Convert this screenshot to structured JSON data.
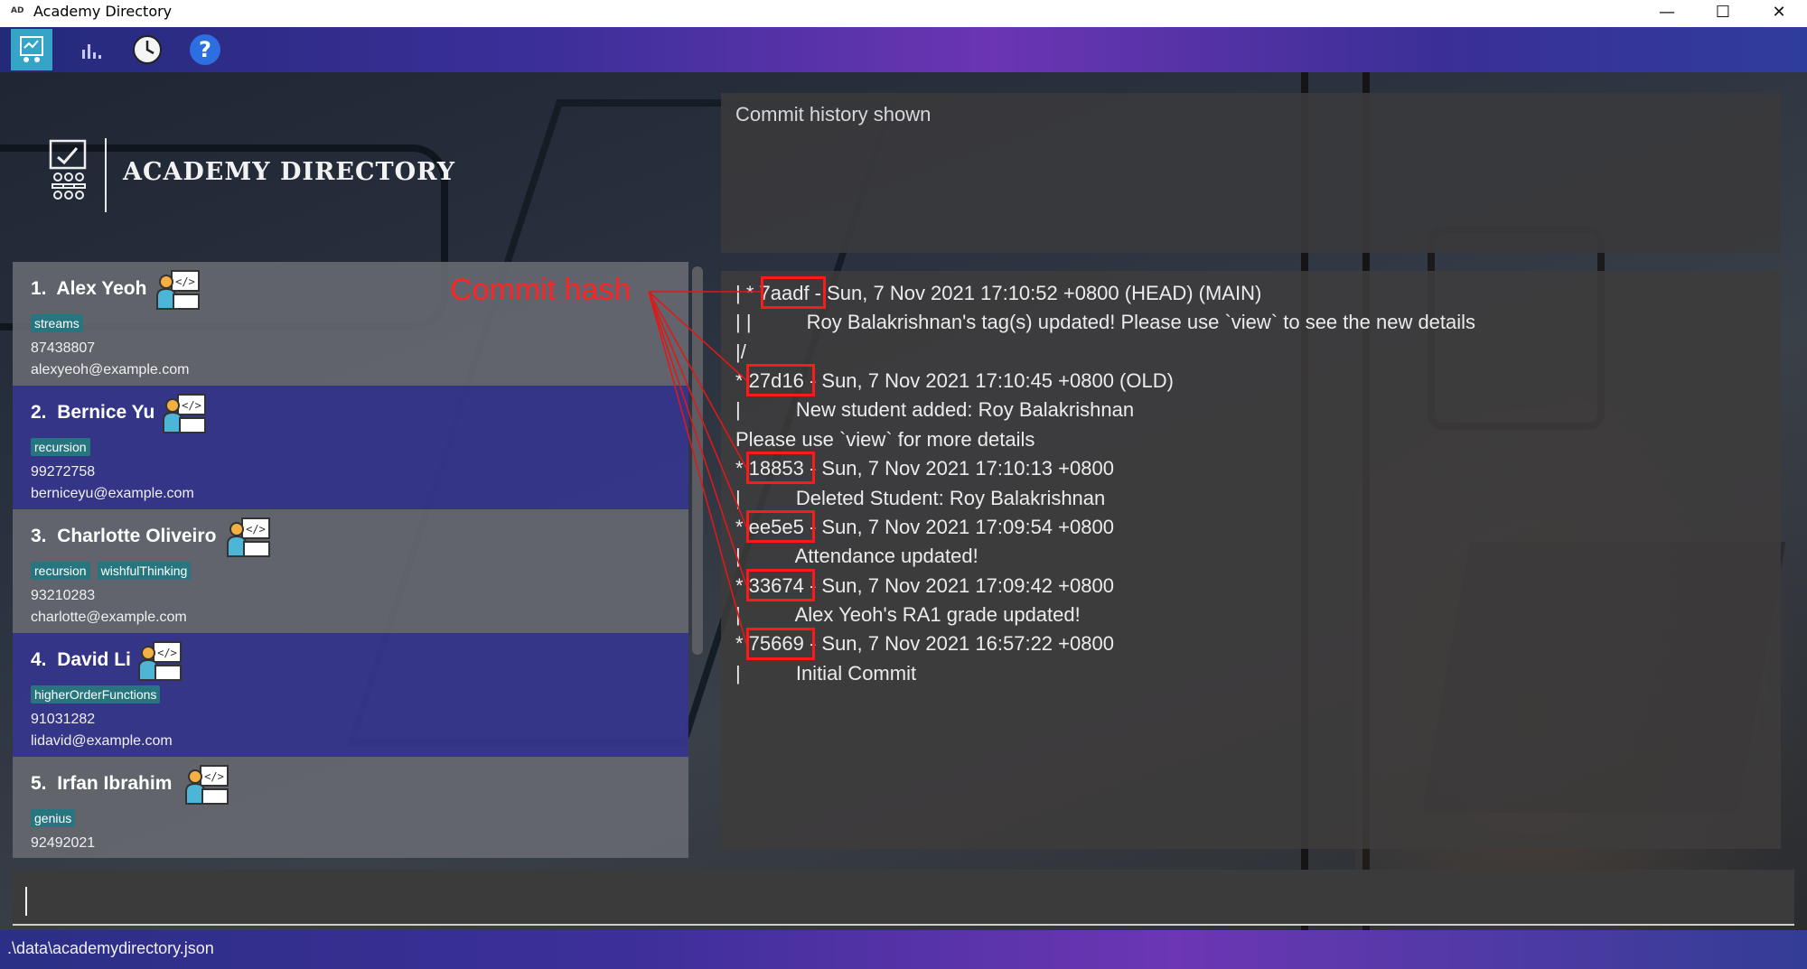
{
  "window": {
    "title": "Academy Directory",
    "app_icon_text": "AD",
    "minimize": "—",
    "maximize": "☐",
    "close": "✕"
  },
  "toolbar": {
    "items": [
      {
        "name": "directory",
        "icon": "directory-icon",
        "active": true
      },
      {
        "name": "visualize",
        "icon": "bar-chart-icon"
      },
      {
        "name": "history",
        "icon": "clock-icon"
      },
      {
        "name": "help",
        "icon": "help-icon"
      }
    ]
  },
  "brand": {
    "title": "ACADEMY DIRECTORY"
  },
  "students": [
    {
      "index": "1.",
      "name": "Alex Yeoh",
      "tags": [
        "streams"
      ],
      "phone": "87438807",
      "email": "alexyeoh@example.com"
    },
    {
      "index": "2.",
      "name": "Bernice Yu",
      "tags": [
        "recursion"
      ],
      "phone": "99272758",
      "email": "berniceyu@example.com"
    },
    {
      "index": "3.",
      "name": "Charlotte Oliveiro",
      "tags": [
        "recursion",
        "wishfulThinking"
      ],
      "phone": "93210283",
      "email": "charlotte@example.com"
    },
    {
      "index": "4.",
      "name": "David Li",
      "tags": [
        "higherOrderFunctions"
      ],
      "phone": "91031282",
      "email": "lidavid@example.com"
    },
    {
      "index": "5.",
      "name": "Irfan Ibrahim",
      "tags": [
        "genius"
      ],
      "phone": "92492021",
      "email": ""
    }
  ],
  "result": {
    "text": "Commit history shown"
  },
  "annotation": {
    "label": "Commit hash",
    "color": "#ff2424"
  },
  "commit_log": {
    "lines": [
      "| * 7aadf - Sun, 7 Nov 2021 17:10:52 +0800 (HEAD) (MAIN)",
      "| |          Roy Balakrishnan's tag(s) updated! Please use `view` to see the new details",
      "|/",
      "* 27d16 - Sun, 7 Nov 2021 17:10:45 +0800 (OLD)",
      "|          New student added: Roy Balakrishnan",
      "Please use `view` for more details",
      "* 18853 - Sun, 7 Nov 2021 17:10:13 +0800",
      "|          Deleted Student: Roy Balakrishnan",
      "* ee5e5 - Sun, 7 Nov 2021 17:09:54 +0800",
      "|          Attendance updated!",
      "* 33674 - Sun, 7 Nov 2021 17:09:42 +0800",
      "|          Alex Yeoh's RA1 grade updated!",
      "* 75669 - Sun, 7 Nov 2021 16:57:22 +0800",
      "|          Initial Commit"
    ]
  },
  "command": {
    "value": ""
  },
  "status": {
    "path": ".\\data\\academydirectory.json"
  }
}
